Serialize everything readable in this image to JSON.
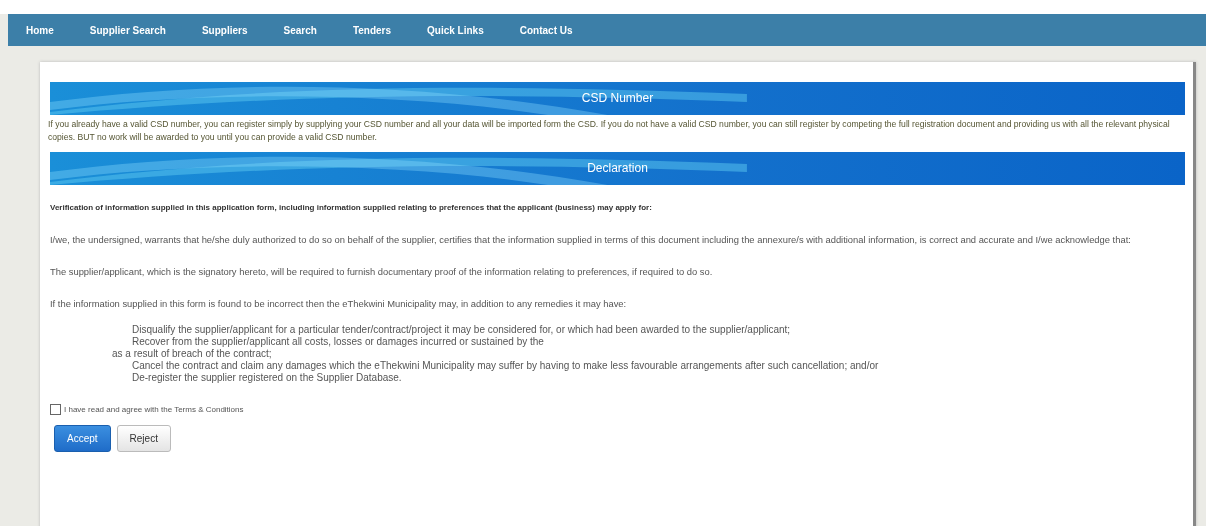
{
  "nav": {
    "items": [
      "Home",
      "Supplier Search",
      "Suppliers",
      "Search",
      "Tenders",
      "Quick Links",
      "Contact Us"
    ]
  },
  "sections": [
    {
      "title": "CSD Number",
      "body": [
        "If you already have a valid CSD number, you can register simply by supplying your CSD number and all your data will be imported form the CSD. If you do not have a valid CSD number, you can still register by competing the full registration document and providing us with all the relevant physical copies. BUT no work will be awarded to you until you can provide a valid CSD number."
      ]
    },
    {
      "title": "Declaration"
    }
  ],
  "declaration": {
    "heading": "Verification of information supplied in this application form, including information supplied relating to preferences that the applicant (business) may apply for:",
    "paragraphs": [
      "I/we, the undersigned, warrants that he/she duly authorized to do so on behalf of the supplier, certifies that the information supplied in terms of this document including the annexure/s with additional information, is correct and accurate and I/we acknowledge that:",
      "The supplier/applicant, which is the signatory hereto, will be required to furnish documentary proof of the information relating to preferences, if required to do so.",
      "If the information supplied in this form is found to be incorrect then the eThekwini Municipality may, in addition to any remedies it may have:"
    ],
    "list": [
      {
        "kind": "item",
        "text": "Disqualify the supplier/applicant for a particular tender/contract/project it may be considered for, or which had been awarded to the supplier/applicant;"
      },
      {
        "kind": "item",
        "text": "Recover from the supplier/applicant all costs, losses or damages incurred or sustained by the"
      },
      {
        "kind": "continuation",
        "text": "as a result of breach of the contract;"
      },
      {
        "kind": "item",
        "text": "Cancel the contract and claim any damages which the eThekwini Municipality may suffer by having to make less favourable arrangements after such cancellation; and/or"
      },
      {
        "kind": "item",
        "text": "De-register the supplier registered on the Supplier Database."
      }
    ]
  },
  "agree": {
    "label": "I have read and agree with the Terms & Conditions",
    "checked": false
  },
  "buttons": [
    {
      "label": "Accept",
      "kind": "primary"
    },
    {
      "label": "Reject",
      "kind": "default"
    }
  ]
}
